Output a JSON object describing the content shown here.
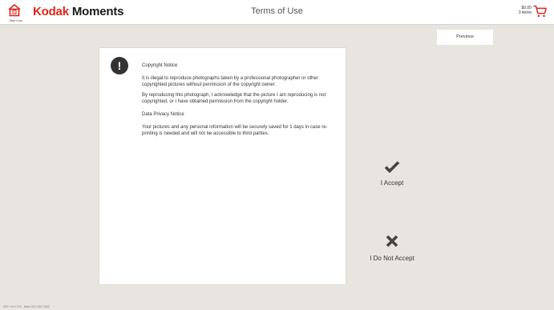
{
  "header": {
    "start_over_label": "Start Over",
    "brand_kodak": "Kodak",
    "brand_moments": "Moments",
    "title": "Terms of Use",
    "cart_total": "$0.00",
    "cart_items": "0 items",
    "brand_color": "#e2231a"
  },
  "toolbar": {
    "previous_label": "Previous"
  },
  "notice": {
    "icon": "exclamation-icon",
    "copyright_heading": "Copyright Notice",
    "copyright_p1": "It is illegal to reproduce photographs taken by a professional photographer or other copyrighted pictures without permission of the copyright owner.",
    "copyright_p2": "By reproducing this photograph, I acknowledge that the picture I am reproducing is not copyrighted, or I have obtained permission from the copyright holder.",
    "privacy_heading": "Data Privacy Notice",
    "privacy_p1": "Your pictures and any personal information will be securely saved for 1 days in case re-printing is needed and will not be accessible to third parties."
  },
  "actions": {
    "accept_label": "I Accept",
    "decline_label": "I Do Not Accept",
    "accept_icon": "checkmark-icon",
    "decline_icon": "x-icon"
  },
  "footer": {
    "build_info": "KPK+ V4.0 IT10 - Build: 2017.0327.2302"
  }
}
